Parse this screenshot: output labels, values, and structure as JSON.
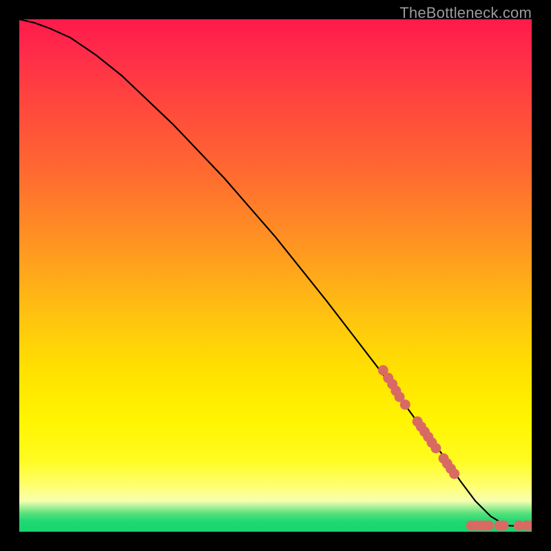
{
  "attribution": "TheBottleneck.com",
  "chart_data": {
    "type": "line",
    "title": "",
    "xlabel": "",
    "ylabel": "",
    "xlim": [
      0,
      100
    ],
    "ylim": [
      0,
      100
    ],
    "grid": false,
    "legend": false,
    "series": [
      {
        "name": "curve",
        "x": [
          0,
          3,
          6,
          10,
          15,
          20,
          30,
          40,
          50,
          60,
          70,
          78,
          83,
          86,
          89,
          92,
          95,
          100
        ],
        "y": [
          100,
          99.3,
          98.2,
          96.4,
          93,
          89,
          79.5,
          69,
          57.5,
          45,
          32,
          21,
          14.5,
          10,
          6,
          3,
          1.2,
          1
        ]
      }
    ],
    "dots": {
      "name": "dots",
      "color": "#d96a63",
      "points": [
        {
          "x": 71,
          "y": 31.5
        },
        {
          "x": 72,
          "y": 30
        },
        {
          "x": 72.8,
          "y": 28.8
        },
        {
          "x": 73.5,
          "y": 27.5
        },
        {
          "x": 74.2,
          "y": 26.3
        },
        {
          "x": 75.3,
          "y": 24.8
        },
        {
          "x": 77.7,
          "y": 21.5
        },
        {
          "x": 78.4,
          "y": 20.5
        },
        {
          "x": 79.1,
          "y": 19.5
        },
        {
          "x": 79.8,
          "y": 18.5
        },
        {
          "x": 80.5,
          "y": 17.4
        },
        {
          "x": 81.3,
          "y": 16.3
        },
        {
          "x": 82.8,
          "y": 14.3
        },
        {
          "x": 83.5,
          "y": 13.3
        },
        {
          "x": 84.2,
          "y": 12.3
        },
        {
          "x": 84.9,
          "y": 11.3
        },
        {
          "x": 88.2,
          "y": 1.2
        },
        {
          "x": 89.2,
          "y": 1.2
        },
        {
          "x": 90.0,
          "y": 1.2
        },
        {
          "x": 90.8,
          "y": 1.2
        },
        {
          "x": 91.6,
          "y": 1.2
        },
        {
          "x": 93.7,
          "y": 1.2
        },
        {
          "x": 94.5,
          "y": 1.2
        },
        {
          "x": 97.5,
          "y": 1.2
        },
        {
          "x": 99.0,
          "y": 1.2
        },
        {
          "x": 99.8,
          "y": 1.2
        }
      ]
    }
  }
}
